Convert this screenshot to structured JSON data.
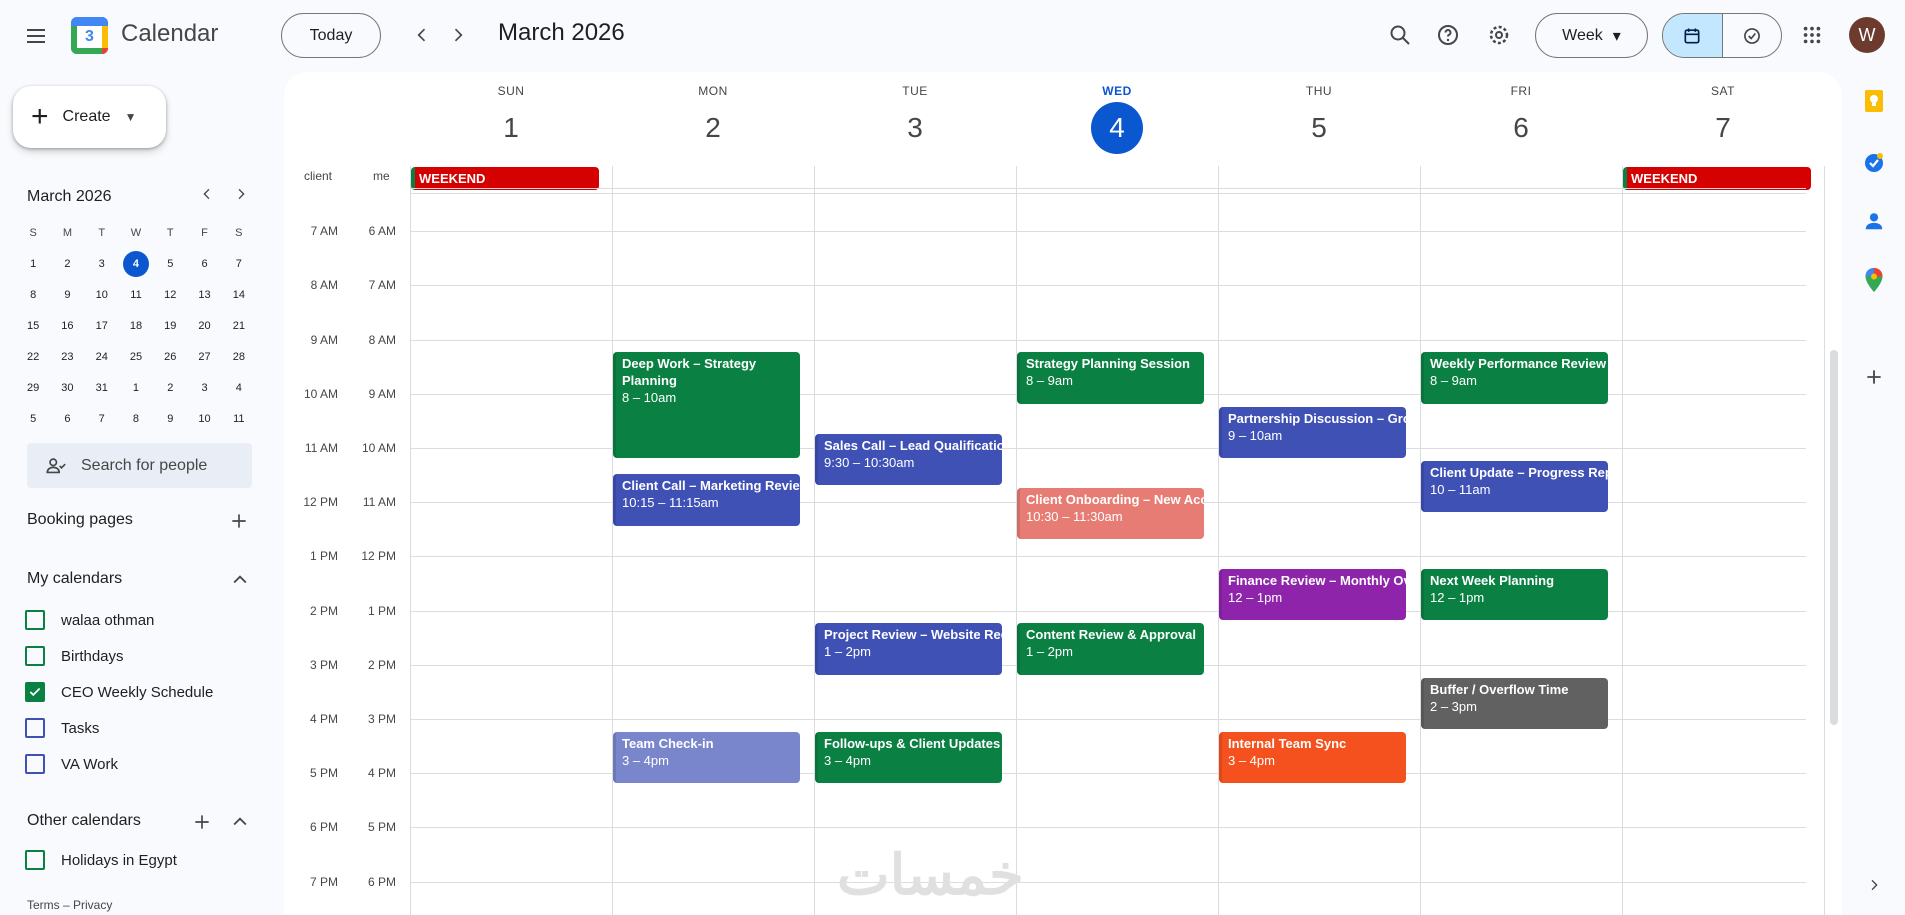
{
  "app": {
    "title": "Calendar",
    "logo_day": "3"
  },
  "toolbar": {
    "today_label": "Today",
    "month_title": "March 2026",
    "view_label": "Week",
    "avatar_initial": "W"
  },
  "sidebar": {
    "create_label": "Create",
    "mini_title": "March 2026",
    "mini_days": [
      "S",
      "M",
      "T",
      "W",
      "T",
      "F",
      "S"
    ],
    "mini_weeks": [
      [
        "1",
        "2",
        "3",
        "4",
        "5",
        "6",
        "7"
      ],
      [
        "8",
        "9",
        "10",
        "11",
        "12",
        "13",
        "14"
      ],
      [
        "15",
        "16",
        "17",
        "18",
        "19",
        "20",
        "21"
      ],
      [
        "22",
        "23",
        "24",
        "25",
        "26",
        "27",
        "28"
      ],
      [
        "29",
        "30",
        "31",
        "1",
        "2",
        "3",
        "4"
      ],
      [
        "5",
        "6",
        "7",
        "8",
        "9",
        "10",
        "11"
      ]
    ],
    "search_people_placeholder": "Search for people",
    "booking_pages_label": "Booking pages",
    "my_calendars_label": "My calendars",
    "my_calendars": [
      {
        "label": "walaa othman",
        "checked": false,
        "color": "#0b8043"
      },
      {
        "label": "Birthdays",
        "checked": false,
        "color": "#0b8043"
      },
      {
        "label": "CEO Weekly Schedule",
        "checked": true,
        "color": "#0b8043"
      },
      {
        "label": "Tasks",
        "checked": false,
        "color": "#3f51b5"
      },
      {
        "label": "VA Work",
        "checked": false,
        "color": "#3f51b5"
      }
    ],
    "other_calendars_label": "Other calendars",
    "other_calendars": [
      {
        "label": "Holidays in Egypt",
        "checked": false,
        "color": "#0b8043"
      }
    ],
    "footer": "Terms – Privacy"
  },
  "week": {
    "tz_labels": [
      "client",
      "me"
    ],
    "days": [
      {
        "dow": "SUN",
        "num": "1",
        "today": false
      },
      {
        "dow": "MON",
        "num": "2",
        "today": false
      },
      {
        "dow": "TUE",
        "num": "3",
        "today": false
      },
      {
        "dow": "WED",
        "num": "4",
        "today": true
      },
      {
        "dow": "THU",
        "num": "5",
        "today": false
      },
      {
        "dow": "FRI",
        "num": "6",
        "today": false
      },
      {
        "dow": "SAT",
        "num": "7",
        "today": false
      }
    ],
    "allday": [
      {
        "day": 0,
        "title": "WEEKEND"
      },
      {
        "day": 6,
        "title": "WEEKEND"
      }
    ],
    "client_times": [
      "7 AM",
      "8 AM",
      "9 AM",
      "10 AM",
      "11 AM",
      "12 PM",
      "1 PM",
      "2 PM",
      "3 PM",
      "4 PM",
      "5 PM",
      "6 PM",
      "7 PM"
    ],
    "me_times": [
      "6 AM",
      "7 AM",
      "8 AM",
      "9 AM",
      "10 AM",
      "11 AM",
      "12 PM",
      "1 PM",
      "2 PM",
      "3 PM",
      "4 PM",
      "5 PM",
      "6 PM"
    ],
    "first_hour": 6,
    "events": [
      {
        "day": 1,
        "start": 8,
        "end": 10,
        "title": "Deep Work – Strategy Planning",
        "time": "8 – 10am",
        "color": "#0b8043",
        "wrap": true
      },
      {
        "day": 1,
        "start": 10.25,
        "end": 11.25,
        "title": "Client Call – Marketing Review",
        "time": "10:15 – 11:15am",
        "color": "#3f51b5"
      },
      {
        "day": 1,
        "start": 15,
        "end": 16,
        "title": "Team Check-in",
        "time": "3 – 4pm",
        "color": "#7986cb"
      },
      {
        "day": 2,
        "start": 9.5,
        "end": 10.5,
        "title": "Sales Call – Lead Qualification",
        "time": "9:30 – 10:30am",
        "color": "#3f51b5"
      },
      {
        "day": 2,
        "start": 13,
        "end": 14,
        "title": "Project Review – Website Redesign",
        "time": "1 – 2pm",
        "color": "#3f51b5"
      },
      {
        "day": 2,
        "start": 15,
        "end": 16,
        "title": "Follow-ups & Client Updates",
        "time": "3 – 4pm",
        "color": "#0b8043"
      },
      {
        "day": 3,
        "start": 8,
        "end": 9,
        "title": "Strategy Planning Session",
        "time": "8 – 9am",
        "color": "#0b8043"
      },
      {
        "day": 3,
        "start": 10.5,
        "end": 11.5,
        "title": "Client Onboarding – New Account",
        "time": "10:30 – 11:30am",
        "color": "#e67c73"
      },
      {
        "day": 3,
        "start": 13,
        "end": 14,
        "title": "Content Review & Approval",
        "time": "1 – 2pm",
        "color": "#0b8043"
      },
      {
        "day": 4,
        "start": 9,
        "end": 10,
        "title": "Partnership Discussion – Growth",
        "time": "9 – 10am",
        "color": "#3f51b5"
      },
      {
        "day": 4,
        "start": 12,
        "end": 13,
        "title": "Finance Review – Monthly Overview",
        "time": "12 – 1pm",
        "color": "#8e24aa"
      },
      {
        "day": 4,
        "start": 15,
        "end": 16,
        "title": "Internal Team Sync",
        "time": "3 – 4pm",
        "color": "#f4511e"
      },
      {
        "day": 5,
        "start": 8,
        "end": 9,
        "title": "Weekly Performance Review",
        "time": "8 – 9am",
        "color": "#0b8043"
      },
      {
        "day": 5,
        "start": 10,
        "end": 11,
        "title": "Client Update – Progress Report",
        "time": "10 – 11am",
        "color": "#3f51b5"
      },
      {
        "day": 5,
        "start": 12,
        "end": 13,
        "title": "Next Week Planning",
        "time": "12 – 1pm",
        "color": "#0b8043"
      },
      {
        "day": 5,
        "start": 14,
        "end": 15,
        "title": "Buffer / Overflow Time",
        "time": "2 – 3pm",
        "color": "#616161"
      }
    ]
  },
  "watermark": "خمسات"
}
